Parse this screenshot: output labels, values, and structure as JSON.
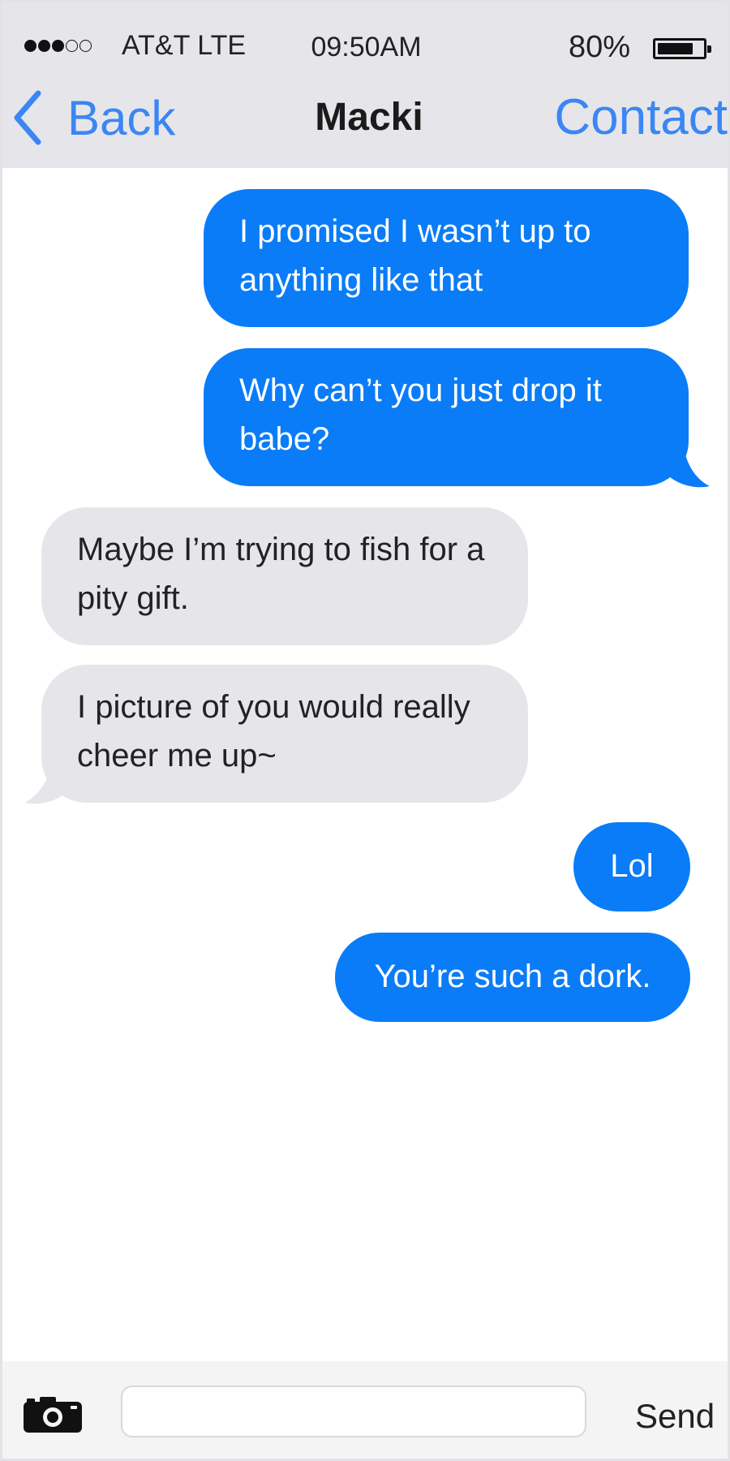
{
  "status_bar": {
    "signal_bars": 3,
    "signal_total": 5,
    "carrier": "AT&T LTE",
    "time": "09:50AM",
    "battery_percent": "80%",
    "battery_level": 0.8
  },
  "nav": {
    "back_label": "Back",
    "title": "Macki",
    "contact_label": "Contact"
  },
  "messages": [
    {
      "from": "me",
      "text": "I promised I wasn’t up to anything like that"
    },
    {
      "from": "me",
      "text": "Why can’t you just drop it babe?"
    },
    {
      "from": "them",
      "text": "Maybe I’m trying to fish for a pity gift."
    },
    {
      "from": "them",
      "text": "I picture of you would really cheer me up~"
    },
    {
      "from": "me",
      "text": "Lol"
    },
    {
      "from": "me",
      "text": "You’re such a dork."
    }
  ],
  "compose": {
    "input_value": "",
    "input_placeholder": "",
    "send_label": "Send",
    "camera_icon": "camera-icon"
  },
  "colors": {
    "sent_bubble": "#0a7cf7",
    "received_bubble": "#e6e6ea",
    "accent": "#3b86f4"
  }
}
